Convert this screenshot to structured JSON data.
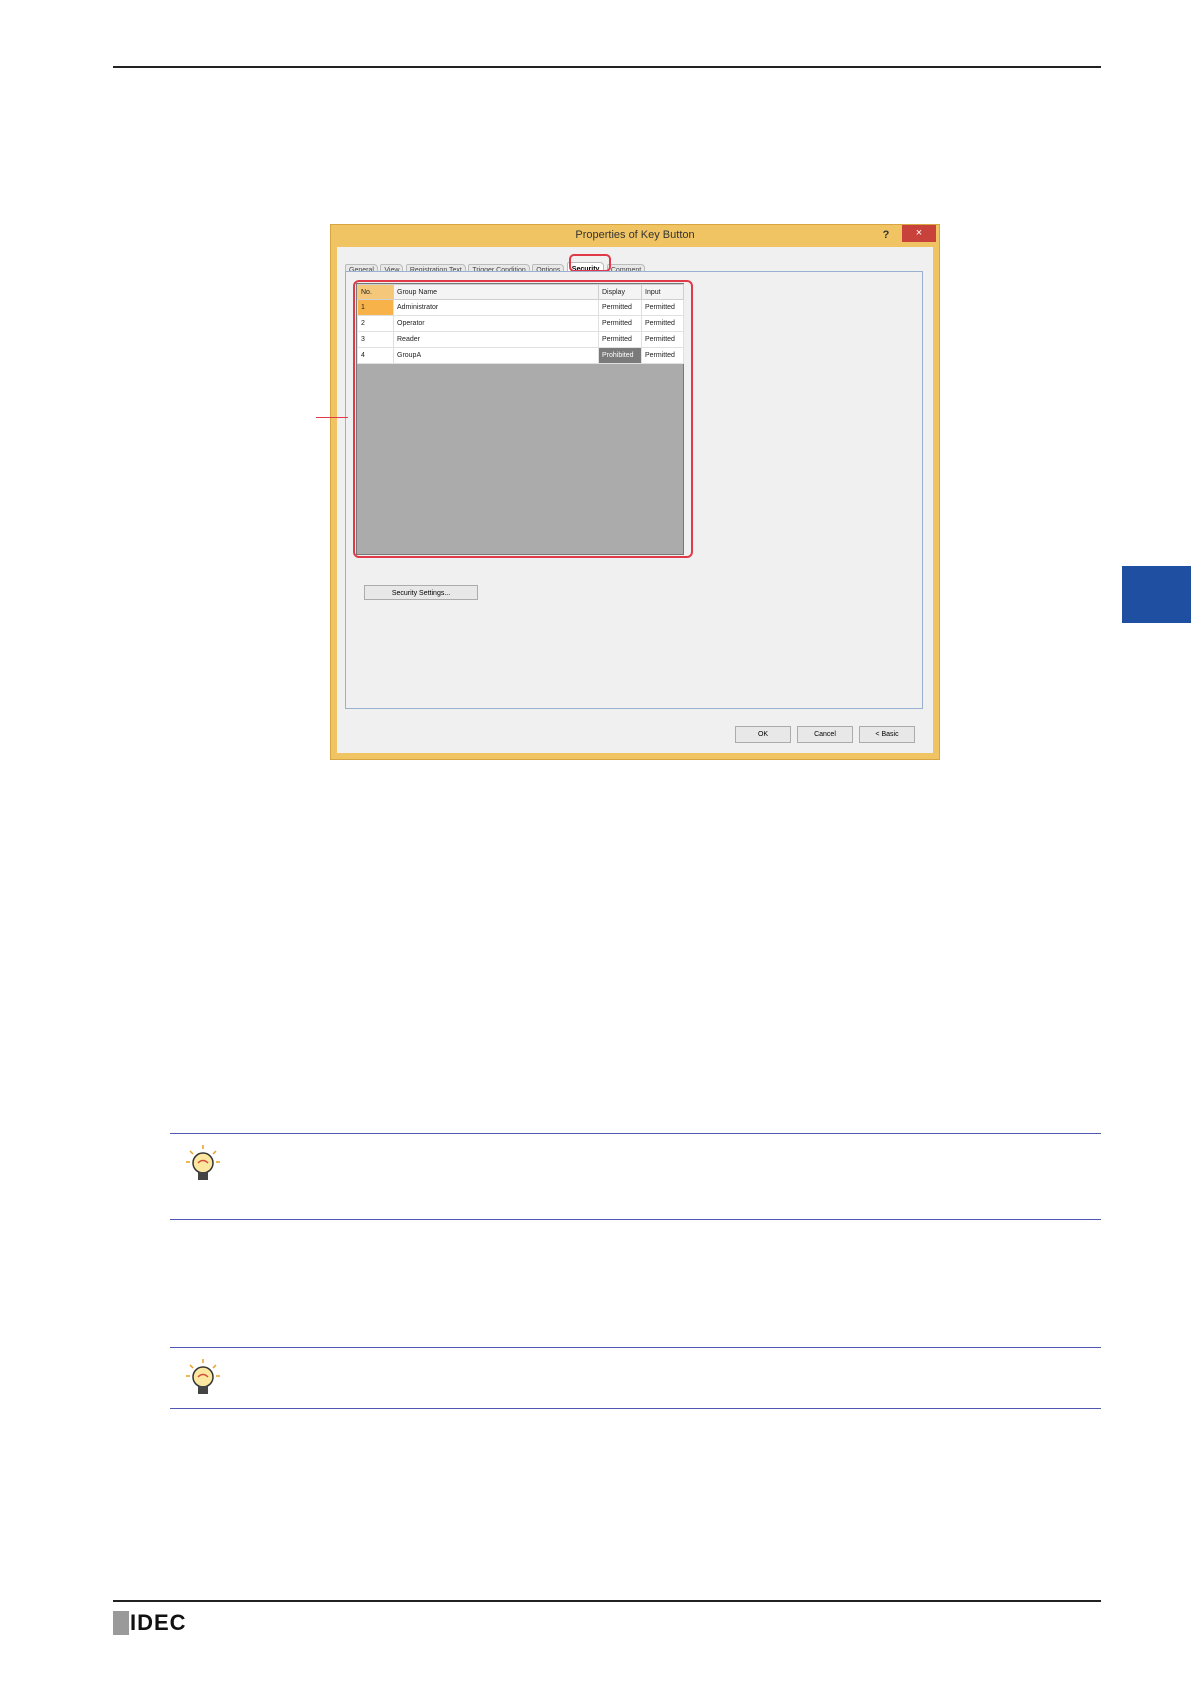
{
  "dialog": {
    "title": "Properties of Key Button",
    "help_label": "?",
    "close_label": "×",
    "tabs": [
      {
        "label": "General"
      },
      {
        "label": "View"
      },
      {
        "label": "Registration Text"
      },
      {
        "label": "Trigger Condition"
      },
      {
        "label": "Options"
      },
      {
        "label": "Security"
      },
      {
        "label": "Comment"
      }
    ],
    "active_tab": "Security",
    "table": {
      "headers": {
        "no": "No.",
        "group": "Group Name",
        "display": "Display",
        "input": "Input"
      },
      "rows": [
        {
          "no": "1",
          "group": "Administrator",
          "display": "Permitted",
          "input": "Permitted"
        },
        {
          "no": "2",
          "group": "Operator",
          "display": "Permitted",
          "input": "Permitted"
        },
        {
          "no": "3",
          "group": "Reader",
          "display": "Permitted",
          "input": "Permitted"
        },
        {
          "no": "4",
          "group": "GroupA",
          "display": "Prohibited",
          "input": "Permitted"
        }
      ]
    },
    "security_settings_label": "Security Settings...",
    "ok_label": "OK",
    "cancel_label": "Cancel",
    "basic_label": "< Basic"
  },
  "colors": {
    "side_tab": "#1f4fa0",
    "highlight": "#e03a48",
    "dialog_frame": "#f0c463"
  },
  "footer": {
    "logo_text": "IDEC"
  }
}
